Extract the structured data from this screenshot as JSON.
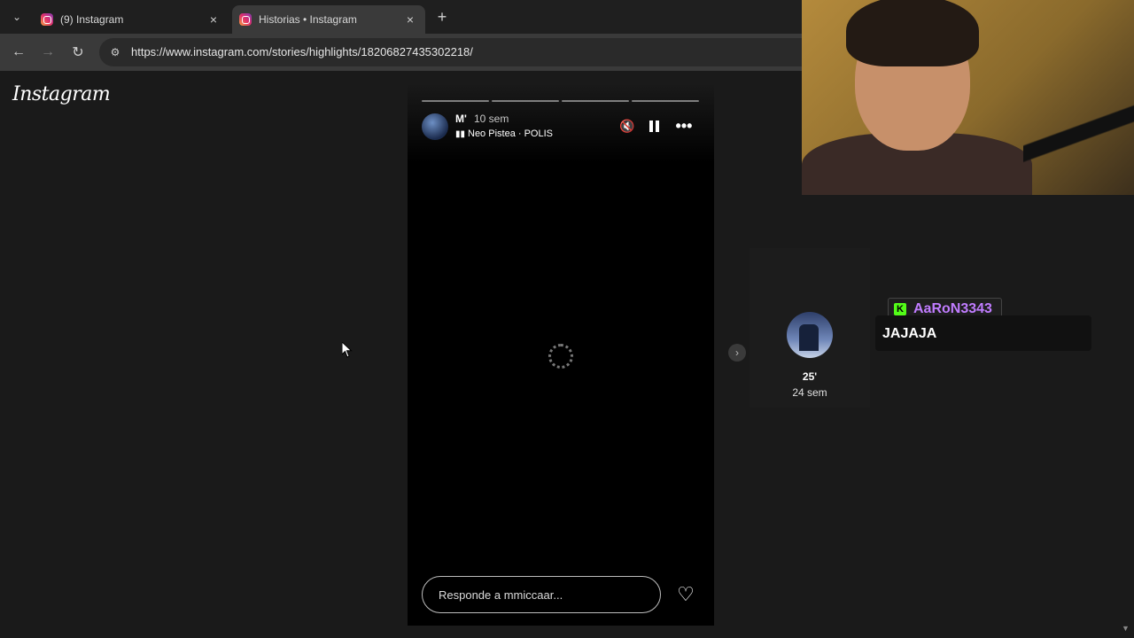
{
  "browser": {
    "tabs": [
      {
        "title": "(9) Instagram",
        "active": false
      },
      {
        "title": "Historias • Instagram",
        "active": true
      }
    ],
    "url": "https://www.instagram.com/stories/highlights/18206827435302218/"
  },
  "instagram": {
    "logo": "Instagram",
    "story": {
      "username": "M'",
      "time": "10 sem",
      "music": "Neo Pistea · POLIS",
      "progress_segments": 4,
      "reply_placeholder": "Responde a mmiccaar..."
    },
    "next_highlight": {
      "title": "25'",
      "time": "24 sem"
    }
  },
  "chat": {
    "username": "AaRoN3343",
    "message": "JAJAJA",
    "platform_icon": "K"
  },
  "icons": {
    "mute": "🔇",
    "more": "•••",
    "heart": "♡",
    "next": "›",
    "back": "←",
    "forward": "→",
    "reload": "↻",
    "new_tab": "+",
    "close": "×",
    "tab_menu": "⌄",
    "site_settings": "⚙",
    "music": "▮▮"
  },
  "colors": {
    "accent_chat_name": "#c07cff",
    "kick_green": "#53fc18"
  }
}
